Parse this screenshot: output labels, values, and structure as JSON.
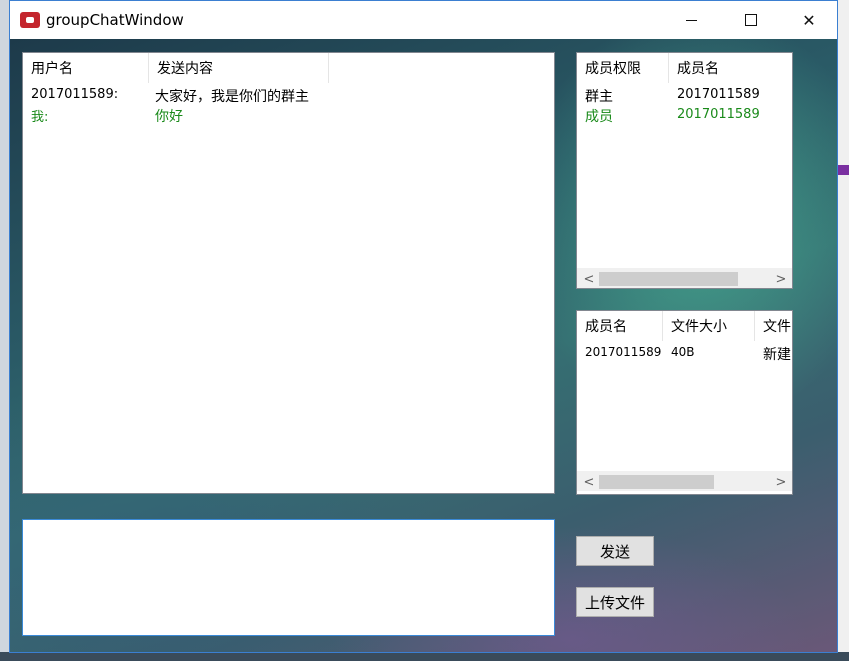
{
  "window": {
    "title": "groupChatWindow"
  },
  "chat": {
    "headers": [
      "用户名",
      "发送内容"
    ],
    "rows": [
      {
        "user": "2017011589:",
        "content": "大家好，我是你们的群主",
        "self": false
      },
      {
        "user": "我:",
        "content": "你好",
        "self": true
      }
    ]
  },
  "members": {
    "headers": [
      "成员权限",
      "成员名"
    ],
    "rows": [
      {
        "role": "群主",
        "name": "2017011589",
        "highlight": false
      },
      {
        "role": "成员",
        "name": "2017011589",
        "highlight": true
      }
    ]
  },
  "files": {
    "headers": [
      "成员名",
      "文件大小",
      "文件"
    ],
    "rows": [
      {
        "member": "2017011589",
        "size": "40B",
        "file": "新建"
      }
    ]
  },
  "buttons": {
    "send": "发送",
    "upload": "上传文件"
  },
  "colors": {
    "self_text": "#1a8a1a",
    "accent_border": "#3b8ad8"
  }
}
